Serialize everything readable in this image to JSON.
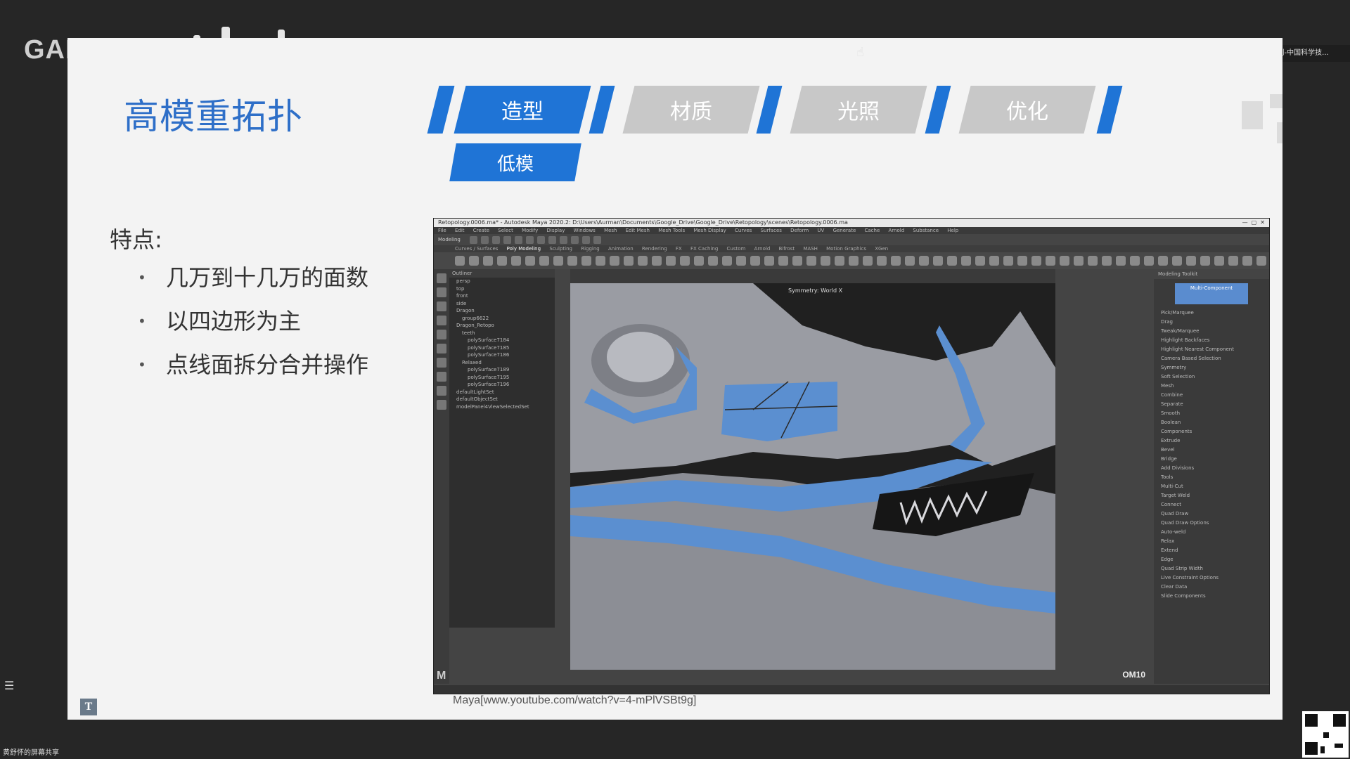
{
  "outer": {
    "title_partial": "GAM",
    "share_note": "正在讲话: 刘利刚-中国科学技...",
    "bottom_bar": "黄舒怀的屏幕共享"
  },
  "slide": {
    "title": "高模重拓扑",
    "tabs": [
      {
        "label": "造型",
        "active": true
      },
      {
        "label": "材质",
        "active": false
      },
      {
        "label": "光照",
        "active": false
      },
      {
        "label": "优化",
        "active": false
      }
    ],
    "subtab": "低模",
    "feature_heading": "特点:",
    "bullets": [
      "几万到十几万的面数",
      "以四边形为主",
      "点线面拆分合并操作"
    ],
    "bullet_mark": "•",
    "caption": "Maya[www.youtube.com/watch?v=4-mPlVSBt9g]",
    "logo_glyph": "T"
  },
  "maya": {
    "window_title": "Retopology.0006.ma* - Autodesk Maya 2020.2: D:\\Users\\Aurman\\Documents\\Google_Drive\\Google_Drive\\Retopology\\scenes\\Retopology.0006.ma",
    "menus": [
      "File",
      "Edit",
      "Create",
      "Select",
      "Modify",
      "Display",
      "Windows",
      "Mesh",
      "Edit Mesh",
      "Mesh Tools",
      "Mesh Display",
      "Curves",
      "Surfaces",
      "Deform",
      "UV",
      "Generate",
      "Cache",
      "Arnold",
      "Substance",
      "Help"
    ],
    "mode": "Modeling",
    "shelf_tabs": [
      "Curves / Surfaces",
      "Poly Modeling",
      "Sculpting",
      "Rigging",
      "Animation",
      "Rendering",
      "FX",
      "FX Caching",
      "Custom",
      "Arnold",
      "Bifrost",
      "MASH",
      "Motion Graphics",
      "XGen"
    ],
    "active_shelf": "Poly Modeling",
    "outliner_header": "Outliner",
    "outliner_items": [
      "persp",
      "top",
      "front",
      "side",
      "Dragon",
      "group6622",
      "Dragon_Retopo",
      "teeth",
      "polySurface7184",
      "polySurface7185",
      "polySurface7186",
      "Relaxed",
      "polySurface7189",
      "polySurface7195",
      "polySurface7196",
      "defaultLightSet",
      "defaultObjectSet",
      "modelPanel4ViewSelectedSet"
    ],
    "viewport_label": "Symmetry: World X",
    "modeling_toolkit_header": "Modeling Toolkit",
    "toolkit_multicomp": "Multi-Component",
    "toolkit_rows": [
      "Pick/Marquee",
      "Drag",
      "Tweak/Marquee",
      "Highlight Backfaces",
      "Highlight Nearest Component",
      "Camera Based Selection",
      "Symmetry",
      "Soft Selection",
      "Mesh",
      "Combine",
      "Separate",
      "Smooth",
      "Boolean",
      "Components",
      "Extrude",
      "Bevel",
      "Bridge",
      "Add Divisions",
      "Tools",
      "Multi-Cut",
      "Target Weld",
      "Connect",
      "Quad Draw",
      "Quad Draw Options",
      "Auto-weld",
      "Relax",
      "Extend",
      "Edge",
      "Quad Strip Width",
      "Live Constraint Options",
      "Clear Data",
      "Slide Components"
    ],
    "watermark": "OM10",
    "logo": "M"
  }
}
